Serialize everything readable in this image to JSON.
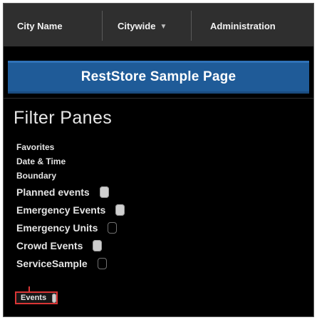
{
  "nav": {
    "city_name": "City Name",
    "citywide": "Citywide",
    "administration": "Administration"
  },
  "banner": {
    "title": "RestStore Sample Page"
  },
  "filter_panes": {
    "title": "Filter Panes",
    "items": [
      {
        "label": "Favorites",
        "toggle": null
      },
      {
        "label": "Date & Time",
        "toggle": null
      },
      {
        "label": "Boundary",
        "toggle": null
      },
      {
        "label": "Planned events",
        "toggle": "on"
      },
      {
        "label": "Emergency Events",
        "toggle": "on"
      },
      {
        "label": "Emergency Units",
        "toggle": "off"
      },
      {
        "label": "Crowd Events",
        "toggle": "on"
      },
      {
        "label": "ServiceSample",
        "toggle": "off"
      }
    ],
    "highlighted": {
      "label": "Events",
      "toggle": "on"
    }
  },
  "colors": {
    "topbar": "#2f2f2f",
    "banner": "#1f5b98",
    "highlight_border": "#d93535"
  }
}
